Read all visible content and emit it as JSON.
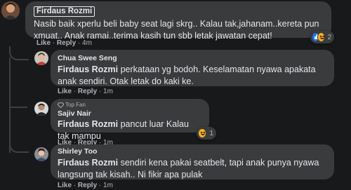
{
  "comments": [
    {
      "author": "Firdaus Rozmi",
      "text": "Nasib baik xperlu beli baby seat lagi skrg.. Kalau tak,jahanam..kereta pun xmuat.. Anak ramai..terima kasih tun sbb letak jawatan cepat!",
      "like": "Like",
      "reply": "Reply",
      "time": "4m",
      "reaction_count": "2",
      "reactions": [
        "like-icon",
        "haha-icon"
      ]
    },
    {
      "author": "Chua Swee Seng",
      "tag": "Firdaus Rozmi",
      "text": "perkataan yg bodoh. Keselamatan nyawa apakata anak sendiri. Otak letak do kaki ke.",
      "like": "Like",
      "reply": "Reply",
      "time": "1m"
    },
    {
      "badge": "Top Fan",
      "author": "Sajiv Nair",
      "tag": "Firdaus Rozmi",
      "text": "pancut luar Kalau tak mampu",
      "like": "Like",
      "reply": "Reply",
      "time": "1m",
      "reaction_count": "1",
      "reactions": [
        "haha-icon"
      ]
    },
    {
      "author": "Shirley Too",
      "tag": "Firdaus Rozmi",
      "text": "sendiri kena pakai seatbelt, tapi anak punya nyawa langsung tak kisah.. Ni fikir apa pulak",
      "like": "Like",
      "reply": "Reply",
      "time": "1m"
    }
  ],
  "colors": {
    "background": "#18191a",
    "bubble": "#3a3b3c",
    "text": "#e4e6eb",
    "meta": "#b0b3b8",
    "like_blue": "#1877f2",
    "haha_yellow": "#f7b125"
  }
}
